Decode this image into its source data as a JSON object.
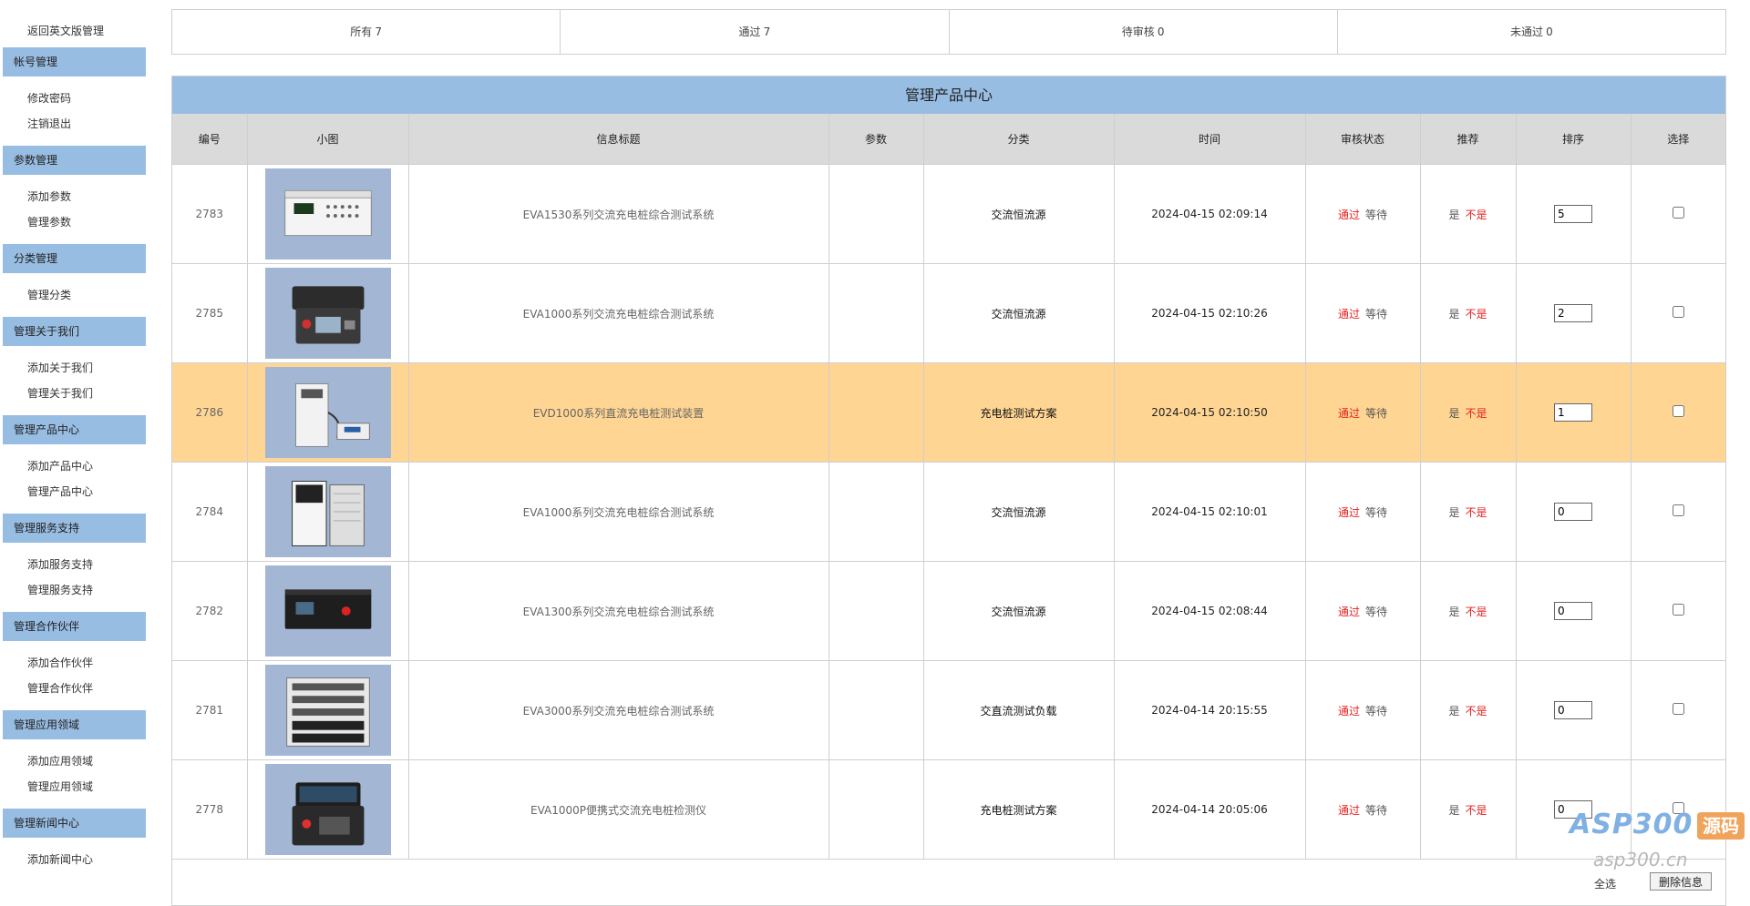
{
  "sidebar": {
    "back_link": "返回英文版管理",
    "groups": [
      {
        "title": "帐号管理",
        "items": [
          "修改密码",
          "注销退出"
        ]
      },
      {
        "title": "参数管理",
        "items": [
          "添加参数",
          "管理参数"
        ]
      },
      {
        "title": "分类管理",
        "items": [
          "管理分类"
        ]
      },
      {
        "title": "管理关于我们",
        "items": [
          "添加关于我们",
          "管理关于我们"
        ]
      },
      {
        "title": "管理产品中心",
        "items": [
          "添加产品中心",
          "管理产品中心"
        ]
      },
      {
        "title": "管理服务支持",
        "items": [
          "添加服务支持",
          "管理服务支持"
        ]
      },
      {
        "title": "管理合作伙伴",
        "items": [
          "添加合作伙伴",
          "管理合作伙伴"
        ]
      },
      {
        "title": "管理应用领域",
        "items": [
          "添加应用领域",
          "管理应用领域"
        ]
      },
      {
        "title": "管理新闻中心",
        "items": [
          "添加新闻中心"
        ]
      }
    ]
  },
  "status_tabs": [
    {
      "label": "所有",
      "count": "7"
    },
    {
      "label": "通过",
      "count": "7"
    },
    {
      "label": "待审核",
      "count": "0"
    },
    {
      "label": "未通过",
      "count": "0"
    }
  ],
  "panel": {
    "title": "管理产品中心",
    "columns": [
      "编号",
      "小图",
      "信息标题",
      "参数",
      "分类",
      "时间",
      "审核状态",
      "推荐",
      "排序",
      "选择"
    ],
    "approve_pass": "通过",
    "approve_wait": "等待",
    "recommend_yes": "是",
    "recommend_no": "不是",
    "rows": [
      {
        "id": "2783",
        "image": "benchtop-instrument",
        "title": "EVA1530系列交流充电桩综合测试系统",
        "param": "",
        "category": "交流恒流源",
        "time": "2024-04-15 02:09:14",
        "sort": "5",
        "highlight": false
      },
      {
        "id": "2785",
        "image": "portable-case",
        "title": "EVA1000系列交流充电桩综合测试系统",
        "param": "",
        "category": "交流恒流源",
        "time": "2024-04-15 02:10:26",
        "sort": "2",
        "highlight": false
      },
      {
        "id": "2786",
        "image": "cabinet-with-cart",
        "title": "EVD1000系列直流充电桩测试装置",
        "param": "",
        "category": "充电桩测试方案",
        "time": "2024-04-15 02:10:50",
        "sort": "1",
        "highlight": true
      },
      {
        "id": "2784",
        "image": "dual-cabinets",
        "title": "EVA1000系列交流充电桩综合测试系统",
        "param": "",
        "category": "交流恒流源",
        "time": "2024-04-15 02:10:01",
        "sort": "0",
        "highlight": false
      },
      {
        "id": "2782",
        "image": "black-rack-unit",
        "title": "EVA1300系列交流充电桩综合测试系统",
        "param": "",
        "category": "交流恒流源",
        "time": "2024-04-15 02:08:44",
        "sort": "0",
        "highlight": false
      },
      {
        "id": "2781",
        "image": "rack-load-bank",
        "title": "EVA3000系列交流充电桩综合测试系统",
        "param": "",
        "category": "交直流测试负载",
        "time": "2024-04-14 20:15:55",
        "sort": "0",
        "highlight": false
      },
      {
        "id": "2778",
        "image": "portable-tester",
        "title": "EVA1000P便携式交流充电桩检测仪",
        "param": "",
        "category": "充电桩测试方案",
        "time": "2024-04-14 20:05:06",
        "sort": "0",
        "highlight": false
      }
    ]
  },
  "footer": {
    "select_all": "全选",
    "delete_button": "删除信息"
  },
  "watermark": {
    "brand": "ASP300",
    "brand_suffix": "源码",
    "domain": "asp300.cn"
  }
}
